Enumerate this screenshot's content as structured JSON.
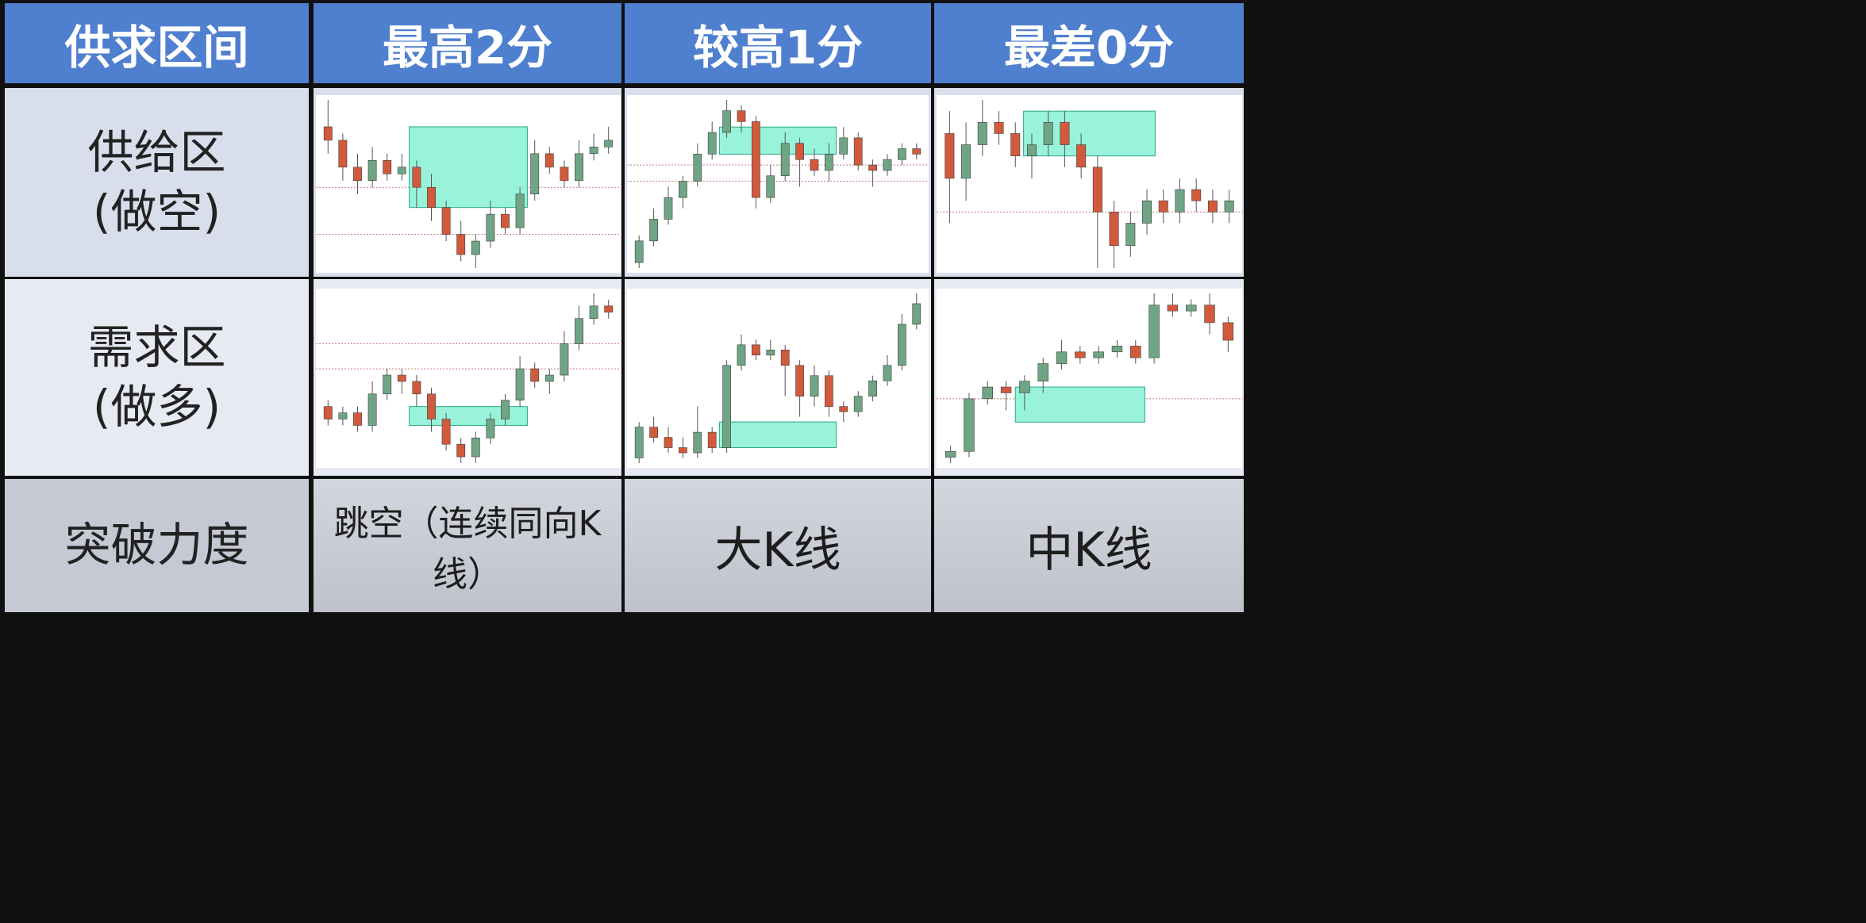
{
  "header": {
    "col0": "供求区间",
    "col1": "最高2分",
    "col2": "较高1分",
    "col3": "最差0分"
  },
  "rows": {
    "supply_line1": "供给区",
    "supply_line2": "(做空)",
    "demand_line1": "需求区",
    "demand_line2": "(做多)",
    "breakout": "突破力度"
  },
  "footer": {
    "col1": "跳空（连续同向K线）",
    "col2": "大K线",
    "col3": "中K线"
  },
  "colors": {
    "header_bg": "#4f7fcf",
    "bull_candle": "#6fa584",
    "bear_candle": "#d25a3c",
    "zone_fill": "#8df2d6",
    "zone_border": "#2aa88a",
    "level_line": "#c87a7a"
  },
  "chart_data": [
    {
      "type": "candlestick",
      "panel": "supply-zone-2-points",
      "bars": [
        [
          30,
          28,
          34,
          26
        ],
        [
          28,
          24,
          29,
          22
        ],
        [
          24,
          22,
          26,
          20
        ],
        [
          22,
          25,
          27,
          21
        ],
        [
          25,
          23,
          26,
          22
        ],
        [
          23,
          24,
          26,
          22
        ],
        [
          24,
          21,
          25,
          18
        ],
        [
          21,
          18,
          23,
          16
        ],
        [
          18,
          14,
          19,
          13
        ],
        [
          14,
          11,
          16,
          10
        ],
        [
          11,
          13,
          14,
          9
        ],
        [
          13,
          17,
          19,
          12
        ],
        [
          17,
          15,
          18,
          14
        ],
        [
          15,
          20,
          21,
          14
        ],
        [
          20,
          26,
          28,
          19
        ],
        [
          26,
          24,
          27,
          23
        ],
        [
          24,
          22,
          25,
          21
        ],
        [
          22,
          26,
          28,
          21
        ],
        [
          26,
          27,
          29,
          25
        ],
        [
          27,
          28,
          30,
          26
        ]
      ],
      "zone": [
        18,
        30
      ],
      "levels": [
        14,
        21
      ]
    },
    {
      "type": "candlestick",
      "panel": "supply-zone-1-point",
      "bars": [
        [
          10,
          14,
          15,
          9
        ],
        [
          14,
          18,
          20,
          13
        ],
        [
          18,
          22,
          24,
          17
        ],
        [
          22,
          25,
          26,
          20
        ],
        [
          25,
          30,
          32,
          24
        ],
        [
          30,
          34,
          36,
          29
        ],
        [
          34,
          38,
          40,
          33
        ],
        [
          38,
          36,
          39,
          34
        ],
        [
          36,
          22,
          37,
          20
        ],
        [
          22,
          26,
          28,
          21
        ],
        [
          26,
          32,
          34,
          25
        ],
        [
          32,
          29,
          33,
          24
        ],
        [
          29,
          27,
          31,
          26
        ],
        [
          27,
          30,
          32,
          25
        ],
        [
          30,
          33,
          35,
          29
        ],
        [
          33,
          28,
          34,
          27
        ],
        [
          28,
          27,
          29,
          24
        ],
        [
          27,
          29,
          30,
          26
        ],
        [
          29,
          31,
          32,
          28
        ],
        [
          31,
          30,
          32,
          29
        ]
      ],
      "zone": [
        30,
        35
      ],
      "levels": [
        25,
        28
      ]
    },
    {
      "type": "candlestick",
      "panel": "supply-zone-0-points",
      "bars": [
        [
          30,
          26,
          32,
          22
        ],
        [
          26,
          29,
          31,
          24
        ],
        [
          29,
          31,
          33,
          28
        ],
        [
          31,
          30,
          32,
          29
        ],
        [
          30,
          28,
          31,
          27
        ],
        [
          28,
          29,
          30,
          26
        ],
        [
          29,
          31,
          32,
          28
        ],
        [
          31,
          29,
          32,
          27
        ],
        [
          29,
          27,
          30,
          26
        ],
        [
          27,
          23,
          28,
          18
        ],
        [
          23,
          20,
          24,
          18
        ],
        [
          20,
          22,
          23,
          19
        ],
        [
          22,
          24,
          25,
          21
        ],
        [
          24,
          23,
          25,
          22
        ],
        [
          23,
          25,
          26,
          22
        ],
        [
          25,
          24,
          26,
          23
        ],
        [
          24,
          23,
          25,
          22
        ],
        [
          23,
          24,
          25,
          22
        ]
      ],
      "zone": [
        28,
        32
      ],
      "levels": [
        23
      ]
    },
    {
      "type": "candlestick",
      "panel": "demand-zone-2-points",
      "bars": [
        [
          20,
          18,
          21,
          17
        ],
        [
          18,
          19,
          20,
          17
        ],
        [
          19,
          17,
          20,
          16
        ],
        [
          17,
          22,
          24,
          16
        ],
        [
          22,
          25,
          26,
          21
        ],
        [
          25,
          24,
          26,
          22
        ],
        [
          24,
          22,
          25,
          20
        ],
        [
          22,
          18,
          23,
          16
        ],
        [
          18,
          14,
          19,
          13
        ],
        [
          14,
          12,
          15,
          11
        ],
        [
          12,
          15,
          16,
          11
        ],
        [
          15,
          18,
          19,
          14
        ],
        [
          18,
          21,
          22,
          17
        ],
        [
          21,
          26,
          28,
          20
        ],
        [
          26,
          24,
          27,
          23
        ],
        [
          24,
          25,
          26,
          22
        ],
        [
          25,
          30,
          32,
          24
        ],
        [
          30,
          34,
          36,
          29
        ],
        [
          34,
          36,
          38,
          33
        ],
        [
          36,
          35,
          37,
          34
        ]
      ],
      "zone": [
        17,
        20
      ],
      "levels": [
        26,
        30
      ]
    },
    {
      "type": "candlestick",
      "panel": "demand-zone-1-point",
      "bars": [
        [
          10,
          16,
          17,
          9
        ],
        [
          16,
          14,
          18,
          13
        ],
        [
          14,
          12,
          16,
          11
        ],
        [
          12,
          11,
          14,
          10
        ],
        [
          11,
          15,
          20,
          10
        ],
        [
          15,
          12,
          16,
          11
        ],
        [
          12,
          28,
          29,
          11
        ],
        [
          28,
          32,
          34,
          27
        ],
        [
          32,
          30,
          33,
          29
        ],
        [
          30,
          31,
          33,
          29
        ],
        [
          31,
          28,
          32,
          22
        ],
        [
          28,
          22,
          29,
          18
        ],
        [
          22,
          26,
          28,
          20
        ],
        [
          26,
          20,
          27,
          18
        ],
        [
          20,
          19,
          21,
          17
        ],
        [
          19,
          22,
          23,
          18
        ],
        [
          22,
          25,
          26,
          21
        ],
        [
          25,
          28,
          30,
          24
        ],
        [
          28,
          36,
          38,
          27
        ],
        [
          36,
          40,
          42,
          35
        ]
      ],
      "zone": [
        12,
        17
      ],
      "levels": []
    },
    {
      "type": "candlestick",
      "panel": "demand-zone-0-points",
      "bars": [
        [
          10,
          11,
          12,
          9
        ],
        [
          11,
          20,
          21,
          10
        ],
        [
          20,
          22,
          23,
          19
        ],
        [
          22,
          21,
          23,
          18
        ],
        [
          21,
          23,
          24,
          18
        ],
        [
          23,
          26,
          27,
          21
        ],
        [
          26,
          28,
          30,
          25
        ],
        [
          28,
          27,
          29,
          26
        ],
        [
          27,
          28,
          29,
          26
        ],
        [
          28,
          29,
          30,
          27
        ],
        [
          29,
          27,
          30,
          26
        ],
        [
          27,
          36,
          38,
          26
        ],
        [
          36,
          35,
          38,
          34
        ],
        [
          35,
          36,
          37,
          34
        ],
        [
          36,
          33,
          38,
          31
        ],
        [
          33,
          30,
          34,
          28
        ]
      ],
      "zone": [
        16,
        22
      ],
      "levels": [
        20
      ]
    }
  ]
}
